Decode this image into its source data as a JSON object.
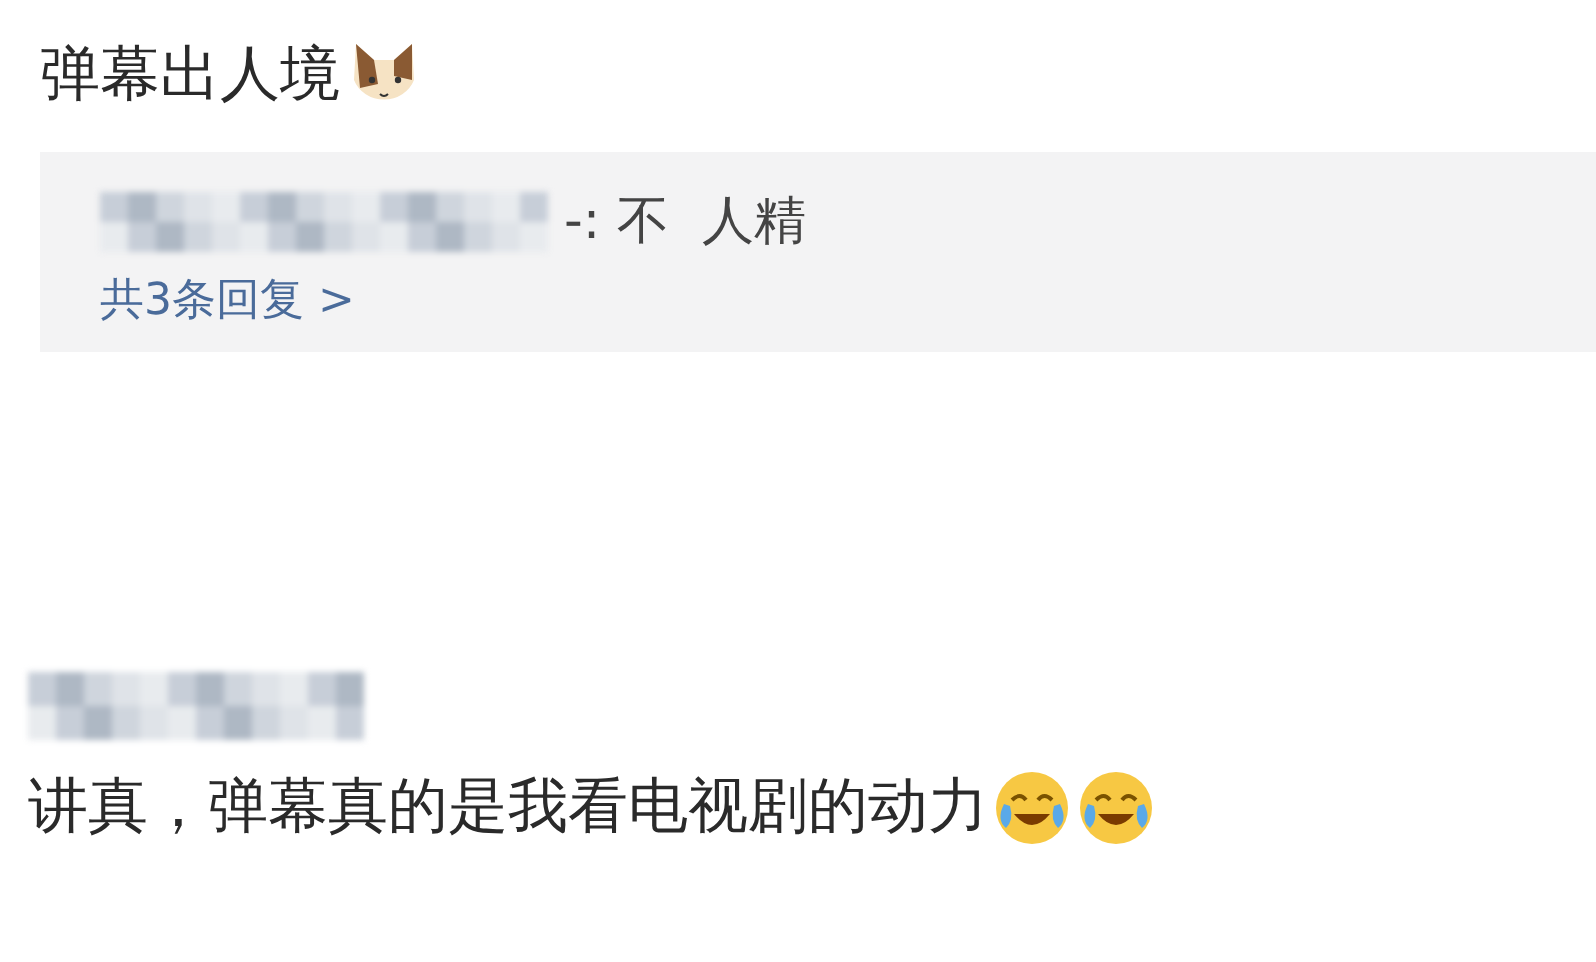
{
  "comments": [
    {
      "text": "弹幕出人境",
      "reply": {
        "text": "-: 不  人精",
        "more": "共3条回复 >"
      }
    },
    {
      "text": "讲真，弹幕真的是我看电视剧的动力"
    }
  ]
}
